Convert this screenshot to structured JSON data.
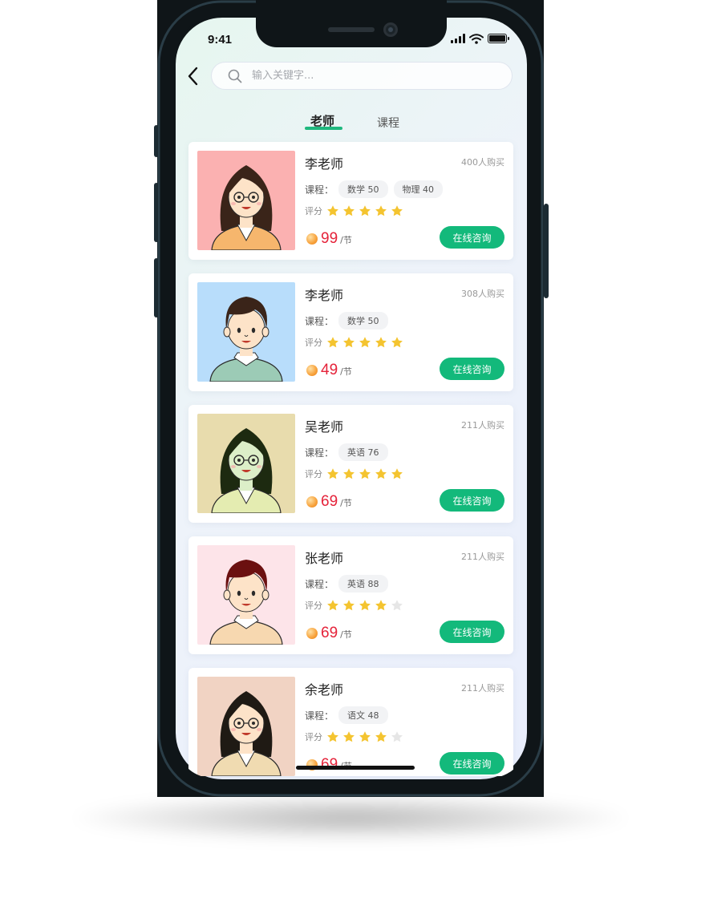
{
  "status_bar": {
    "time": "9:41"
  },
  "search": {
    "placeholder": "输入关键字..."
  },
  "tabs": [
    {
      "label": "老师",
      "active": true
    },
    {
      "label": "课程",
      "active": false
    }
  ],
  "teachers": [
    {
      "name": "李老师",
      "sold": "400人购买",
      "course_label": "课程：",
      "courses": [
        "数学 50",
        "物理 40"
      ],
      "rating_label": "评分",
      "rating": 5,
      "price": "99",
      "unit": "/节",
      "button": "在线咨询",
      "avatar": "female-teacher-glasses-icon",
      "bg": "#fbb1b1"
    },
    {
      "name": "李老师",
      "sold": "308人购买",
      "course_label": "课程：",
      "courses": [
        "数学 50"
      ],
      "rating_label": "评分",
      "rating": 5,
      "price": "49",
      "unit": "/节",
      "button": "在线咨询",
      "avatar": "male-teacher-icon",
      "bg": "#b8ddfb"
    },
    {
      "name": "吴老师",
      "sold": "211人购买",
      "course_label": "课程：",
      "courses": [
        "英语 76"
      ],
      "rating_label": "评分",
      "rating": 5,
      "price": "69",
      "unit": "/节",
      "button": "在线咨询",
      "avatar": "female-teacher-glasses-icon",
      "bg": "#e8dcad"
    },
    {
      "name": "张老师",
      "sold": "211人购买",
      "course_label": "课程：",
      "courses": [
        "英语 88"
      ],
      "rating_label": "评分",
      "rating": 4,
      "price": "69",
      "unit": "/节",
      "button": "在线咨询",
      "avatar": "male-teacher-icon",
      "bg": "#fde4e9"
    },
    {
      "name": "余老师",
      "sold": "211人购买",
      "course_label": "课程：",
      "courses": [
        "语文 48"
      ],
      "rating_label": "评分",
      "rating": 4,
      "price": "69",
      "unit": "/节",
      "button": "在线咨询",
      "avatar": "female-teacher-glasses-icon",
      "bg": "#f1d3c3"
    }
  ],
  "colors": {
    "accent": "#13b97b",
    "price": "#e5233a",
    "star": "#f4c430",
    "star_empty": "#e6e6e6"
  }
}
